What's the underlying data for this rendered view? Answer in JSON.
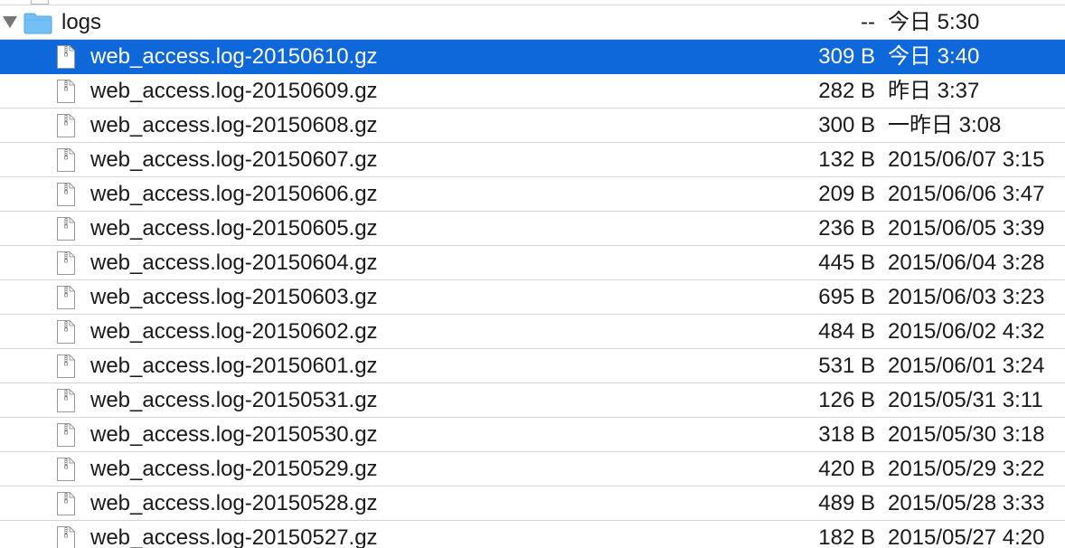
{
  "folder": {
    "name": "logs",
    "size": "--",
    "date": "今日 5:30",
    "icon": "folder-icon",
    "expanded": true
  },
  "colors": {
    "selection": "#0f68d9",
    "folder_blue": "#74c0f4"
  },
  "files": [
    {
      "name": "web_access.log-20150610.gz",
      "size": "309 B",
      "date": "今日 3:40",
      "selected": true
    },
    {
      "name": "web_access.log-20150609.gz",
      "size": "282 B",
      "date": "昨日 3:37"
    },
    {
      "name": "web_access.log-20150608.gz",
      "size": "300 B",
      "date": "一昨日 3:08"
    },
    {
      "name": "web_access.log-20150607.gz",
      "size": "132 B",
      "date": "2015/06/07 3:15"
    },
    {
      "name": "web_access.log-20150606.gz",
      "size": "209 B",
      "date": "2015/06/06 3:47"
    },
    {
      "name": "web_access.log-20150605.gz",
      "size": "236 B",
      "date": "2015/06/05 3:39"
    },
    {
      "name": "web_access.log-20150604.gz",
      "size": "445 B",
      "date": "2015/06/04 3:28"
    },
    {
      "name": "web_access.log-20150603.gz",
      "size": "695 B",
      "date": "2015/06/03 3:23"
    },
    {
      "name": "web_access.log-20150602.gz",
      "size": "484 B",
      "date": "2015/06/02 4:32"
    },
    {
      "name": "web_access.log-20150601.gz",
      "size": "531 B",
      "date": "2015/06/01 3:24"
    },
    {
      "name": "web_access.log-20150531.gz",
      "size": "126 B",
      "date": "2015/05/31 3:11"
    },
    {
      "name": "web_access.log-20150530.gz",
      "size": "318 B",
      "date": "2015/05/30 3:18"
    },
    {
      "name": "web_access.log-20150529.gz",
      "size": "420 B",
      "date": "2015/05/29 3:22"
    },
    {
      "name": "web_access.log-20150528.gz",
      "size": "489 B",
      "date": "2015/05/28 3:33"
    },
    {
      "name": "web_access.log-20150527.gz",
      "size": "182 B",
      "date": "2015/05/27 4:20"
    }
  ]
}
